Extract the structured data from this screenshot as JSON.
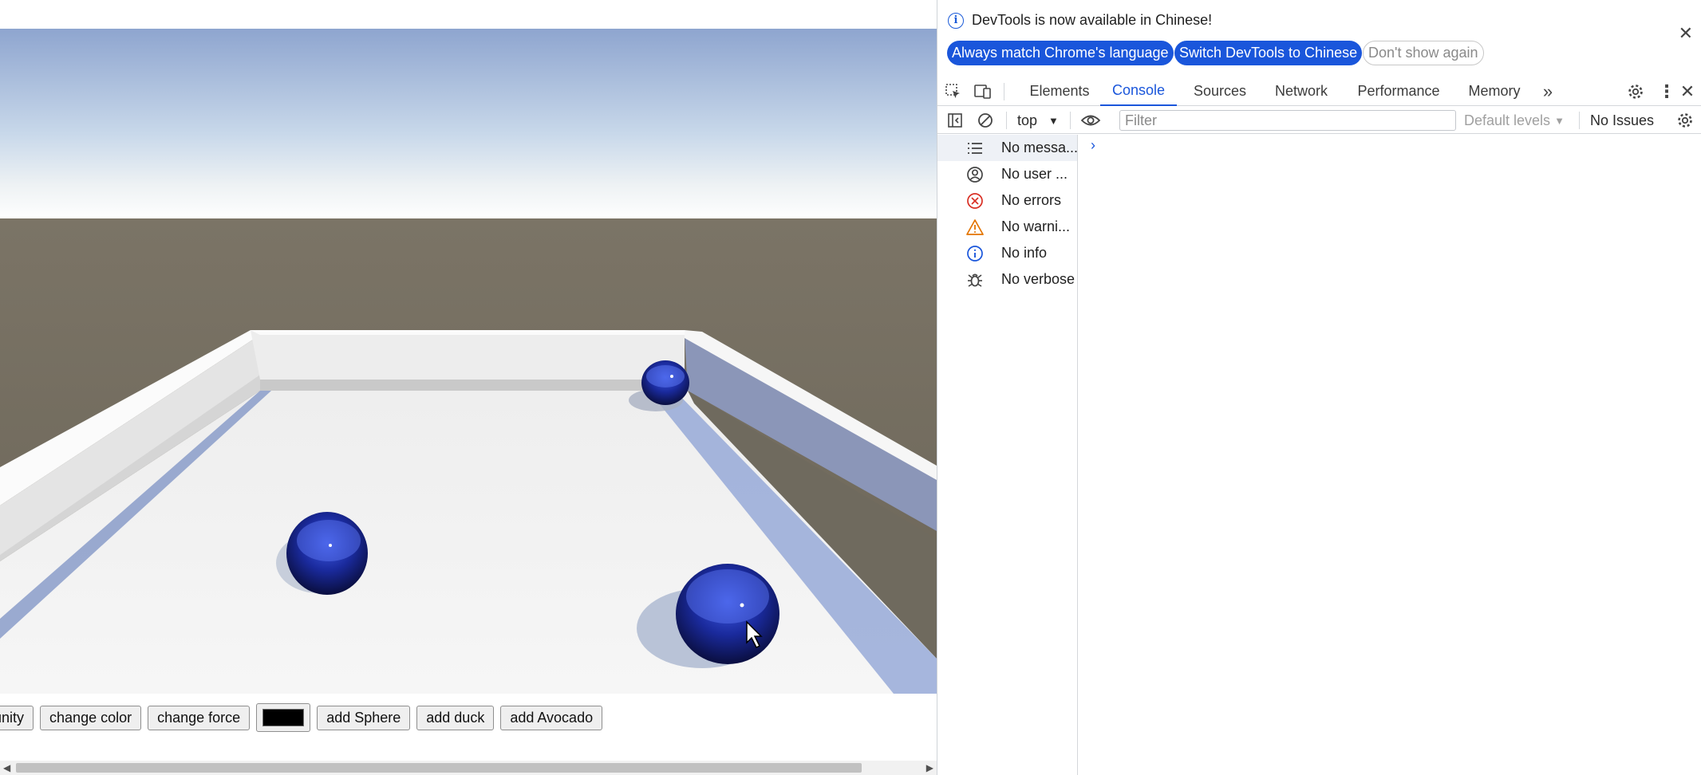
{
  "page": {
    "buttons": [
      {
        "name": "unity-button",
        "label": "unity"
      },
      {
        "name": "change-color-button",
        "label": "change color"
      },
      {
        "name": "change-force-button",
        "label": "change force"
      },
      {
        "name": "color-picker",
        "label": ""
      },
      {
        "name": "add-sphere-button",
        "label": "add Sphere"
      },
      {
        "name": "add-duck-button",
        "label": "add duck"
      },
      {
        "name": "add-avocado-button",
        "label": "add Avocado"
      }
    ],
    "swatch_color": "#000000",
    "sphere_color": "#1a2a9c"
  },
  "devtools": {
    "infobar": {
      "message": "DevTools is now available in Chinese!",
      "always_match": "Always match Chrome's language",
      "switch_chinese": "Switch DevTools to Chinese",
      "dont_show": "Don't show again"
    },
    "tabs": [
      "Elements",
      "Console",
      "Sources",
      "Network",
      "Performance",
      "Memory"
    ],
    "active_tab": "Console",
    "toolbar": {
      "context": "top",
      "filter_placeholder": "Filter",
      "levels": "Default levels",
      "issues": "No Issues"
    },
    "sidebar": [
      {
        "icon": "list-icon",
        "label": "No messa..."
      },
      {
        "icon": "user-icon",
        "label": "No user ..."
      },
      {
        "icon": "error-icon",
        "label": "No errors"
      },
      {
        "icon": "warning-icon",
        "label": "No warni..."
      },
      {
        "icon": "info-icon",
        "label": "No info"
      },
      {
        "icon": "bug-icon",
        "label": "No verbose"
      }
    ],
    "accent": "#1a56db"
  }
}
